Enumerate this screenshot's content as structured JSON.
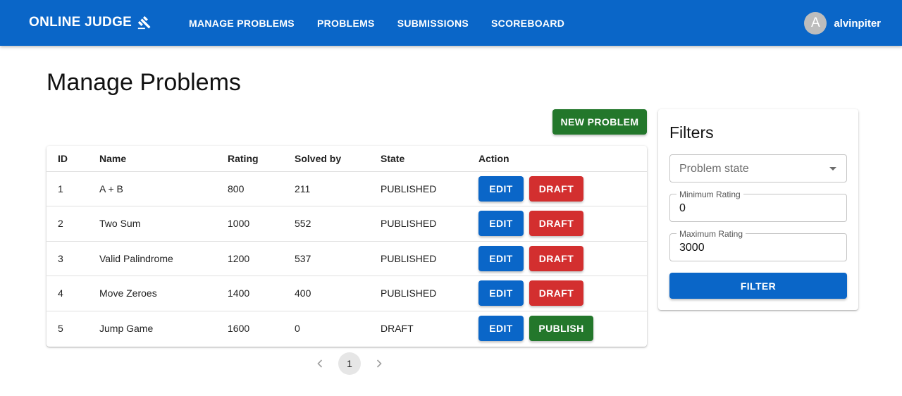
{
  "appbar": {
    "brand": "ONLINE JUDGE",
    "brand_icon": "gavel-icon",
    "nav": [
      "MANAGE PROBLEMS",
      "PROBLEMS",
      "SUBMISSIONS",
      "SCOREBOARD"
    ],
    "user": {
      "avatar_letter": "A",
      "name": "alvinpiter"
    },
    "color": "#0a66c8"
  },
  "page": {
    "title": "Manage Problems"
  },
  "toolbar": {
    "new_problem_label": "NEW PROBLEM"
  },
  "table": {
    "columns": [
      "ID",
      "Name",
      "Rating",
      "Solved by",
      "State",
      "Action"
    ],
    "rows": [
      {
        "id": "1",
        "name": "A + B",
        "rating": "800",
        "solved_by": "211",
        "state": "PUBLISHED",
        "edit": "EDIT",
        "toggle": "DRAFT"
      },
      {
        "id": "2",
        "name": "Two Sum",
        "rating": "1000",
        "solved_by": "552",
        "state": "PUBLISHED",
        "edit": "EDIT",
        "toggle": "DRAFT"
      },
      {
        "id": "3",
        "name": "Valid Palindrome",
        "rating": "1200",
        "solved_by": "537",
        "state": "PUBLISHED",
        "edit": "EDIT",
        "toggle": "DRAFT"
      },
      {
        "id": "4",
        "name": "Move Zeroes",
        "rating": "1400",
        "solved_by": "400",
        "state": "PUBLISHED",
        "edit": "EDIT",
        "toggle": "DRAFT"
      },
      {
        "id": "5",
        "name": "Jump Game",
        "rating": "1600",
        "solved_by": "0",
        "state": "DRAFT",
        "edit": "EDIT",
        "toggle": "PUBLISH"
      }
    ]
  },
  "pagination": {
    "current_page": "1"
  },
  "filters": {
    "title": "Filters",
    "state_placeholder": "Problem state",
    "min_label": "Minimum Rating",
    "min_value": "0",
    "max_label": "Maximum Rating",
    "max_value": "3000",
    "button_label": "FILTER"
  },
  "colors": {
    "primary": "#0a66c8",
    "danger": "#d32f2f",
    "success": "#23772b"
  }
}
